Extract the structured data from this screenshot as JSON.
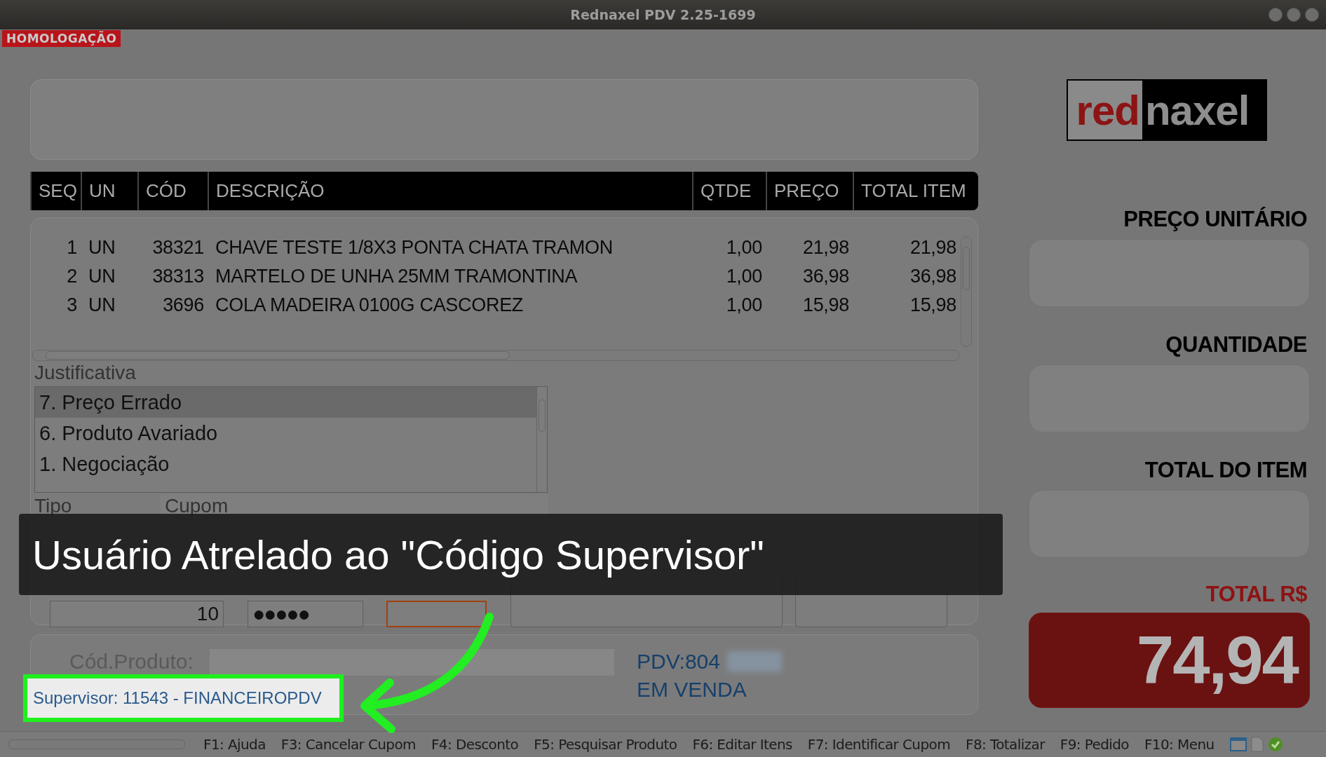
{
  "window": {
    "title": "Rednaxel PDV 2.25-1699"
  },
  "environment_badge": "HOMOLOGAÇÃO",
  "table": {
    "columns": [
      "SEQ",
      "UN",
      "CÓD",
      "DESCRIÇÃO",
      "QTDE",
      "PREÇO",
      "TOTAL ITEM"
    ],
    "rows": [
      [
        "1",
        "UN",
        "38321",
        "CHAVE TESTE 1/8X3 PONTA CHATA TRAMON",
        "1,00",
        "21,98",
        "21,98"
      ],
      [
        "2",
        "UN",
        "38313",
        "MARTELO DE UNHA 25MM TRAMONTINA",
        "1,00",
        "36,98",
        "36,98"
      ],
      [
        "3",
        "UN",
        "3696",
        "COLA MADEIRA 0100G CASCOREZ",
        "1,00",
        "15,98",
        "15,98"
      ]
    ]
  },
  "justificativa": {
    "label": "Justificativa",
    "items": [
      {
        "text": "7. Preço Errado",
        "selected": true
      },
      {
        "text": "6. Produto Avariado",
        "selected": false
      },
      {
        "text": "1. Negociação",
        "selected": false
      }
    ]
  },
  "discount": {
    "tipo_label": "Tipo",
    "cupom_label": "Cupom",
    "percent_value": "10",
    "supervisor_password": "●●●●●",
    "senha": {
      "focused": true
    }
  },
  "footer": {
    "product_code_label": "Cód.Produto:",
    "pdv": "PDV:804",
    "status": "EM VENDA",
    "supervisor": "Supervisor: 11543 - FINANCEIROPDV"
  },
  "side": {
    "logo": [
      "red",
      "naxel"
    ],
    "fields": [
      {
        "label": "PREÇO UNITÁRIO"
      },
      {
        "label": "QUANTIDADE"
      },
      {
        "label": "TOTAL DO ITEM"
      }
    ],
    "total": {
      "label": "TOTAL R$",
      "value": "74,94"
    }
  },
  "status_bar": {
    "shortcuts": [
      "F1: Ajuda",
      "F3: Cancelar Cupom",
      "F4: Desconto",
      "F5: Pesquisar Produto",
      "F6: Editar Itens",
      "F7: Identificar Cupom",
      "F8: Totalizar",
      "F9: Pedido",
      "F10: Menu"
    ]
  },
  "caption": "Usuário Atrelado ao \"Código Supervisor\""
}
